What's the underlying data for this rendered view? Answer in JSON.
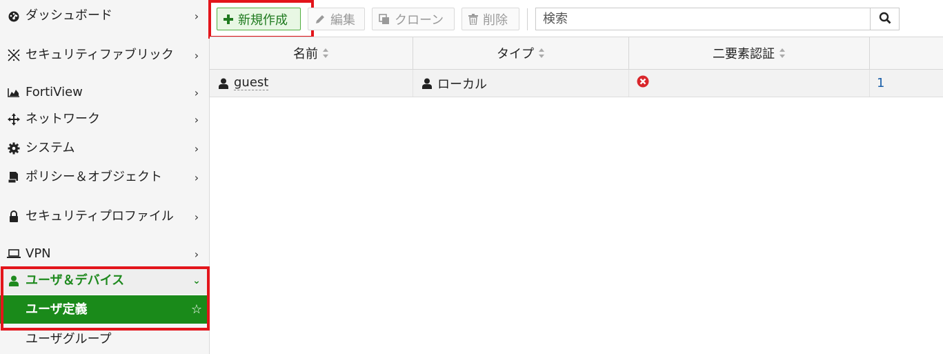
{
  "sidebar": {
    "items": [
      {
        "label": "ダッシュボード",
        "icon": "dashboard-icon"
      },
      {
        "label": "セキュリティファブリック",
        "icon": "security-fabric-icon"
      },
      {
        "label": "FortiView",
        "icon": "fortiview-chart-icon"
      },
      {
        "label": "ネットワーク",
        "icon": "network-arrows-icon"
      },
      {
        "label": "システム",
        "icon": "gear-icon"
      },
      {
        "label": "ポリシー＆オブジェクト",
        "icon": "policy-icon"
      },
      {
        "label": "セキュリティプロファイル",
        "icon": "lock-icon"
      },
      {
        "label": "VPN",
        "icon": "laptop-icon"
      },
      {
        "label": "ユーザ＆デバイス",
        "icon": "user-icon"
      }
    ],
    "sub_items": [
      {
        "label": "ユーザ定義"
      },
      {
        "label": "ユーザグループ"
      }
    ]
  },
  "toolbar": {
    "new_label": "新規作成",
    "edit_label": "編集",
    "clone_label": "クローン",
    "delete_label": "削除",
    "search_placeholder": "検索"
  },
  "table": {
    "columns": [
      "名前",
      "タイプ",
      "二要素認証",
      ""
    ],
    "rows": [
      {
        "name": "guest",
        "type": "ローカル",
        "two_factor": "disabled",
        "ref": "1"
      }
    ]
  },
  "colors": {
    "accent_green": "#1a8a1a",
    "highlight_red": "#e3151b",
    "link_blue": "#1a5fa8",
    "error_red": "#d9262b"
  }
}
